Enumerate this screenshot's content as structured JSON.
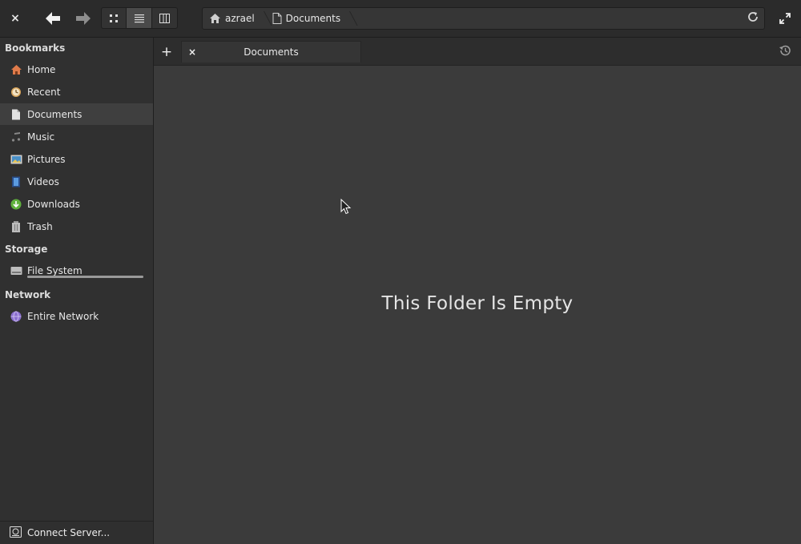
{
  "headerbar": {
    "close_label": "×",
    "path": [
      {
        "label": "azrael",
        "icon": "home-icon"
      },
      {
        "label": "Documents",
        "icon": "document-icon"
      }
    ]
  },
  "sidebar": {
    "bookmarks_heading": "Bookmarks",
    "bookmarks": [
      {
        "label": "Home",
        "icon": "home-icon",
        "color": "#e07b4a"
      },
      {
        "label": "Recent",
        "icon": "clock-icon",
        "color": "#d9a55a"
      },
      {
        "label": "Documents",
        "icon": "document-icon",
        "color": "#dddddd"
      },
      {
        "label": "Music",
        "icon": "music-icon",
        "color": "#888888"
      },
      {
        "label": "Pictures",
        "icon": "pictures-icon",
        "color": "#4a90c8"
      },
      {
        "label": "Videos",
        "icon": "videos-icon",
        "color": "#4a7fd0"
      },
      {
        "label": "Downloads",
        "icon": "download-icon",
        "color": "#5fb13c"
      },
      {
        "label": "Trash",
        "icon": "trash-icon",
        "color": "#bbbbbb"
      }
    ],
    "storage_heading": "Storage",
    "storage": [
      {
        "label": "File System",
        "icon": "drive-icon",
        "usage": 1.0
      }
    ],
    "network_heading": "Network",
    "network": [
      {
        "label": "Entire Network",
        "icon": "network-icon",
        "color": "#8b6fd0"
      }
    ],
    "footer_label": "Connect Server..."
  },
  "tabs": {
    "new_tab_label": "+",
    "items": [
      {
        "label": "Documents",
        "close_label": "×"
      }
    ]
  },
  "content": {
    "empty_message": "This Folder Is Empty"
  }
}
